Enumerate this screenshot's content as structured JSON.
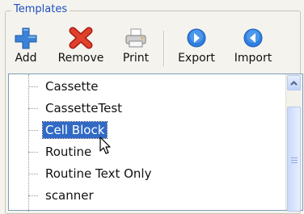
{
  "group": {
    "title": "Templates"
  },
  "toolbar": {
    "add_label": "Add",
    "remove_label": "Remove",
    "print_label": "Print",
    "export_label": "Export",
    "import_label": "Import"
  },
  "tree": {
    "items": [
      {
        "label": "Cassette",
        "selected": false
      },
      {
        "label": "CassetteTest",
        "selected": false
      },
      {
        "label": "Cell Block",
        "selected": true
      },
      {
        "label": "Routine",
        "selected": false
      },
      {
        "label": "Routine Text Only",
        "selected": false
      },
      {
        "label": "scanner",
        "selected": false
      }
    ]
  },
  "colors": {
    "accent": "#1f4fbf",
    "selection": "#316ac5",
    "add_icon": "#3a83d6",
    "remove_icon": "#d6301e",
    "nav_icon": "#2f7fe0"
  },
  "icons": {
    "add": "plus-icon",
    "remove": "x-icon",
    "print": "printer-icon",
    "export": "arrow-right-circle-icon",
    "import": "arrow-left-circle-icon"
  }
}
